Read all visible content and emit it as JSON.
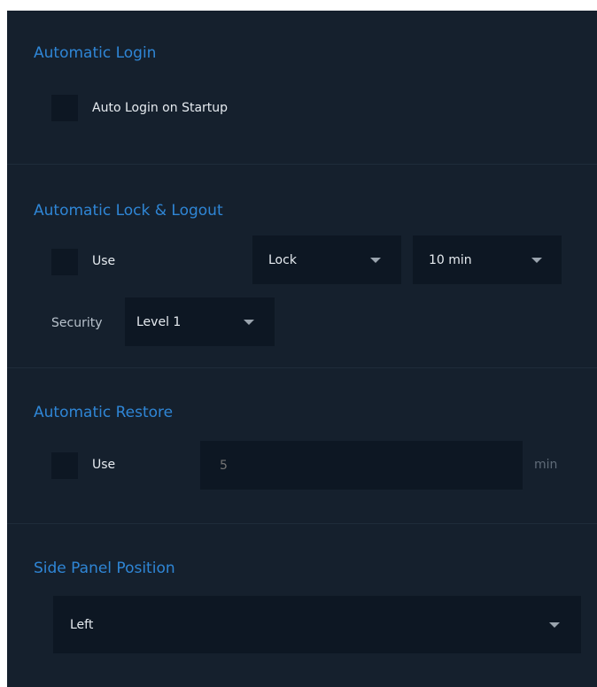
{
  "auto_login": {
    "title": "Automatic Login",
    "startup_label": "Auto Login on Startup"
  },
  "auto_lock": {
    "title": "Automatic Lock & Logout",
    "use_label": "Use",
    "action": {
      "value": "Lock",
      "icon": "chevron-down-icon"
    },
    "timeout": {
      "value": "10 min",
      "icon": "chevron-down-icon"
    },
    "security_label": "Security",
    "security": {
      "value": "Level 1",
      "icon": "chevron-down-icon"
    }
  },
  "auto_restore": {
    "title": "Automatic Restore",
    "use_label": "Use",
    "minutes_placeholder": "5",
    "unit": "min"
  },
  "side_panel": {
    "title": "Side Panel Position",
    "position": {
      "value": "Left",
      "icon": "chevron-down-icon"
    }
  },
  "colors": {
    "panel_background": "#15202d",
    "field_background": "#0d1723",
    "section_title": "#2f86d6",
    "text": "#e6ebf0"
  }
}
